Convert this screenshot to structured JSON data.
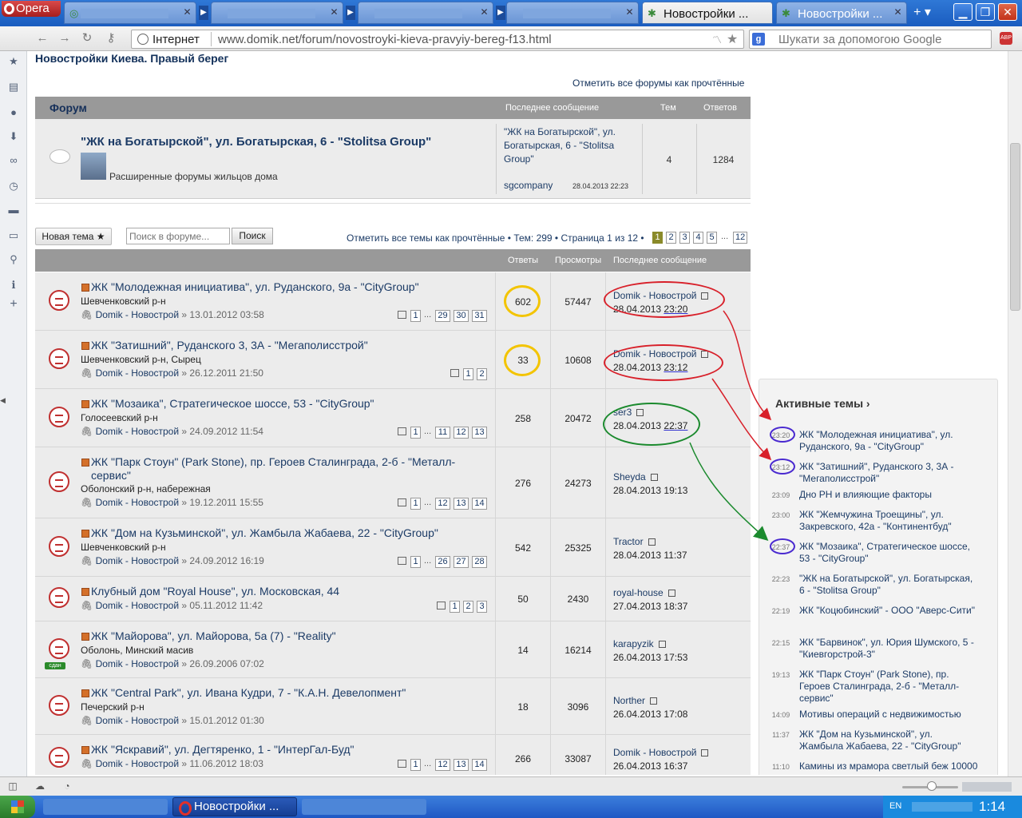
{
  "browser": {
    "menu_label": "Opera",
    "tabs": [
      {
        "label": "",
        "active": false
      },
      {
        "label": "",
        "active": false
      },
      {
        "label": "",
        "active": false
      },
      {
        "label": "",
        "active": false
      },
      {
        "label": "Новостройки ...",
        "active": true
      },
      {
        "label": "Новостройки ...",
        "active": false
      }
    ],
    "zone_label": "Інтернет",
    "url": "www.domik.net/forum/novostroyki-kieva-pravyiy-bereg-f13.html",
    "search_placeholder": "Шукати за допомогою Google",
    "search_engine_letter": "g",
    "adblock_label": "ABP"
  },
  "page": {
    "title": "Новостройки Киева. Правый берег",
    "mark_forums_read": "Отметить все форумы как прочтённые"
  },
  "forum_table": {
    "headers": {
      "forum": "Форум",
      "last_post": "Последнее сообщение",
      "topics": "Тем",
      "replies": "Ответов"
    },
    "row": {
      "title": "\"ЖК на Богатырской\", ул. Богатырская, 6 - \"Stolitsa Group\"",
      "description": "Расширенные форумы жильцов дома",
      "last_post_title": "\"ЖК на Богатырской\", ул. Богатырская, 6 - \"Stolitsa Group\"",
      "last_post_user": "sgcompany",
      "last_post_date": "28.04.2013 22:23",
      "topics": "4",
      "replies": "1284"
    }
  },
  "toolbar": {
    "new_topic": "Новая тема ★",
    "search_placeholder": "Поиск в форуме...",
    "search_button": "Поиск",
    "pagination_info": "Отметить все темы как прочтённые • Тем: 299 • Страница 1 из 12 •",
    "pages": [
      "1",
      "2",
      "3",
      "4",
      "5",
      "...",
      "12"
    ]
  },
  "topics_table": {
    "headers": {
      "replies": "Ответы",
      "views": "Просмотры",
      "last_post": "Последнее сообщение"
    },
    "rows": [
      {
        "title": "ЖК \"Молодежная инициатива\", ул. Руданского, 9а - \"CityGroup\"",
        "district": "Шевченковский р-н",
        "author": "Domik - Новострой",
        "date": "13.01.2012 03:58",
        "pages": [
          "1",
          "...",
          "29",
          "30",
          "31"
        ],
        "replies": "602",
        "views": "57447",
        "last_user": "Domik - Новострой",
        "last_date": "28.04.2013",
        "last_time": "23:20"
      },
      {
        "title": "ЖК \"Затишний\", Руданского 3, 3А - \"Мегаполисстрой\"",
        "district": "Шевченковский р-н, Сырец",
        "author": "Domik - Новострой",
        "date": "26.12.2011 21:50",
        "pages": [
          "1",
          "2"
        ],
        "replies": "33",
        "views": "10608",
        "last_user": "Domik - Новострой",
        "last_date": "28.04.2013",
        "last_time": "23:12"
      },
      {
        "title": "ЖК \"Мозаика\", Стратегическое шоссе, 53 - \"CityGroup\"",
        "district": "Голосеевский р-н",
        "author": "Domik - Новострой",
        "date": "24.09.2012 11:54",
        "pages": [
          "1",
          "...",
          "11",
          "12",
          "13"
        ],
        "replies": "258",
        "views": "20472",
        "last_user": "ser3",
        "last_date": "28.04.2013",
        "last_time": "22:37"
      },
      {
        "title": "ЖК \"Парк Стоун\" (Park Stone), пр. Героев Сталинграда, 2-б - \"Металл-сервис\"",
        "district": "Оболонский р-н, набережная",
        "author": "Domik - Новострой",
        "date": "19.12.2011 15:55",
        "pages": [
          "1",
          "...",
          "12",
          "13",
          "14"
        ],
        "replies": "276",
        "views": "24273",
        "last_user": "Sheyda",
        "last_date": "28.04.2013",
        "last_time": "19:13"
      },
      {
        "title": "ЖК \"Дом на Кузьминской\", ул. Жамбыла Жабаева, 22 - \"CityGroup\"",
        "district": "Шевченковский р-н",
        "author": "Domik - Новострой",
        "date": "24.09.2012 16:19",
        "pages": [
          "1",
          "...",
          "26",
          "27",
          "28"
        ],
        "replies": "542",
        "views": "25325",
        "last_user": "Tractor",
        "last_date": "28.04.2013",
        "last_time": "11:37"
      },
      {
        "title": "Клубный дом \"Royal House\", ул. Московская, 44",
        "district": "",
        "author": "Domik - Новострой",
        "date": "05.11.2012 11:42",
        "pages": [
          "1",
          "2",
          "3"
        ],
        "replies": "50",
        "views": "2430",
        "last_user": "royal-house",
        "last_date": "27.04.2013",
        "last_time": "18:37"
      },
      {
        "title": "ЖК \"Майорова\", ул. Майорова, 5а (7) - \"Reality\"",
        "district": "Оболонь, Минский масив",
        "author": "Domik - Новострой",
        "date": "26.09.2006 07:02",
        "pages": [],
        "replies": "14",
        "views": "16214",
        "last_user": "karapyzik",
        "last_date": "26.04.2013",
        "last_time": "17:53",
        "badge": "сдан"
      },
      {
        "title": "ЖК \"Central Park\", ул. Ивана Кудри, 7 - \"К.А.Н. Девелопмент\"",
        "district": "Печерский р-н",
        "author": "Domik - Новострой",
        "date": "15.01.2012 01:30",
        "pages": [],
        "replies": "18",
        "views": "3096",
        "last_user": "Norther",
        "last_date": "26.04.2013",
        "last_time": "17:08"
      },
      {
        "title": "ЖК \"Яскравий\", ул. Дегтяренко, 1 - \"ИнтерГал-Буд\"",
        "district": "",
        "author": "Domik - Новострой",
        "date": "11.06.2012 18:03",
        "pages": [
          "1",
          "...",
          "12",
          "13",
          "14"
        ],
        "replies": "266",
        "views": "33087",
        "last_user": "Domik - Новострой",
        "last_date": "26.04.2013",
        "last_time": "16:37"
      }
    ]
  },
  "active_topics": {
    "title": "Активные темы ›",
    "items": [
      {
        "time": "23:20",
        "text": "ЖК \"Молодежная инициатива\", ул. Руданского, 9а - \"CityGroup\""
      },
      {
        "time": "23:12",
        "text": "ЖК \"Затишний\", Руданского 3, 3А - \"Мегаполисстрой\""
      },
      {
        "time": "23:09",
        "text": "Дно РН и влияющие факторы"
      },
      {
        "time": "23:00",
        "text": "ЖК \"Жемчужина Троещины\", ул. Закревского, 42а - \"Континентбуд\""
      },
      {
        "time": "22:37",
        "text": "ЖК \"Мозаика\", Стратегическое шоссе, 53 - \"CityGroup\""
      },
      {
        "time": "22:23",
        "text": "\"ЖК на Богатырской\", ул. Богатырская, 6 - \"Stolitsa Group\""
      },
      {
        "time": "22:19",
        "text": "ЖК \"Коцюбинский\" - ООО \"Аверс-Сити\""
      },
      {
        "time": "22:15",
        "text": "ЖК \"Барвинок\", ул. Юрия Шумского, 5 - \"Киевгорстрой-3\""
      },
      {
        "time": "19:13",
        "text": "ЖК \"Парк Стоун\" (Park Stone), пр. Героев Сталинграда, 2-б - \"Металл-сервис\""
      },
      {
        "time": "14:09",
        "text": "Мотивы операций с недвижимостью"
      },
      {
        "time": "11:37",
        "text": "ЖК \"Дом на Кузьминской\", ул. Жамбыла Жабаева, 22 - \"CityGroup\""
      },
      {
        "time": "11:10",
        "text": "Камины из мрамора светлый беж 10000 грн"
      }
    ]
  },
  "taskbar": {
    "opera_task": "Новостройки ...",
    "lang": "EN",
    "clock": "1:14"
  }
}
